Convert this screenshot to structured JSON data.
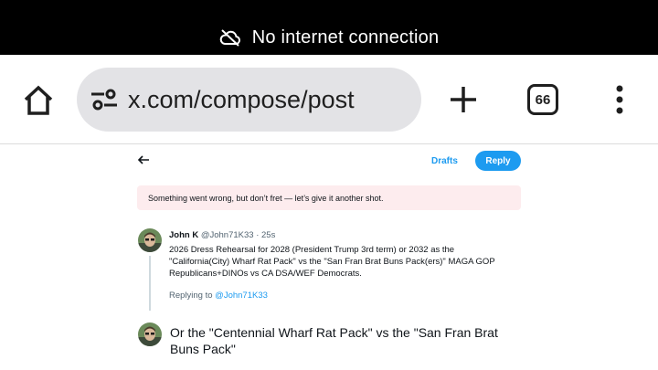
{
  "status_bar": {
    "text": "No internet connection",
    "icon": "cloud-off-icon"
  },
  "browser": {
    "url": "x.com/compose/post",
    "tab_count": "66",
    "icons": [
      "home-icon",
      "tune-icon",
      "plus-icon",
      "menu-dots-icon"
    ]
  },
  "compose_header": {
    "drafts_label": "Drafts",
    "reply_label": "Reply"
  },
  "error": {
    "message": "Something went wrong, but don’t fret — let’s give it another shot."
  },
  "tweet": {
    "name": "John K",
    "handle": "@John71K33",
    "time": "25s",
    "text": "2026 Dress Rehearsal for 2028 (President Trump 3rd term) or 2032 as the \"California(City) Wharf Rat Pack\" vs the \"San Fran Brat Buns Pack(ers)\" MAGA GOP Republicans+DINOs vs CA DSA/WEF Democrats."
  },
  "replying": {
    "prefix": "Replying to ",
    "handle": "@John71K33"
  },
  "draft": {
    "text": "Or the \"Centennial Wharf Rat Pack\" vs the \"San Fran Brat Buns Pack\""
  },
  "colors": {
    "accent": "#1d9bf0",
    "error_bg": "#fdecee"
  }
}
